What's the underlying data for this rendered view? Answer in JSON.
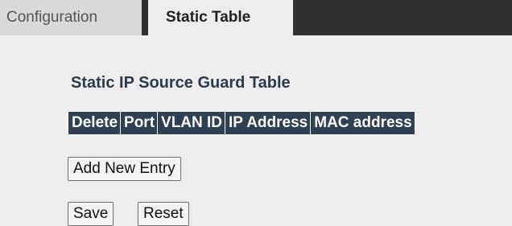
{
  "tabs": {
    "configuration": "Configuration",
    "static_table": "Static Table"
  },
  "section": {
    "title": "Static IP Source Guard Table"
  },
  "table": {
    "columns": [
      "Delete",
      "Port",
      "VLAN ID",
      "IP Address",
      "MAC address"
    ],
    "rows": []
  },
  "buttons": {
    "add_new_entry": "Add New Entry",
    "save": "Save",
    "reset": "Reset"
  },
  "colors": {
    "header_bg": "#2e4052",
    "dark_bar": "#303030",
    "active_tab_bg": "#ededed",
    "inactive_tab_bg": "#d9d9d9"
  }
}
